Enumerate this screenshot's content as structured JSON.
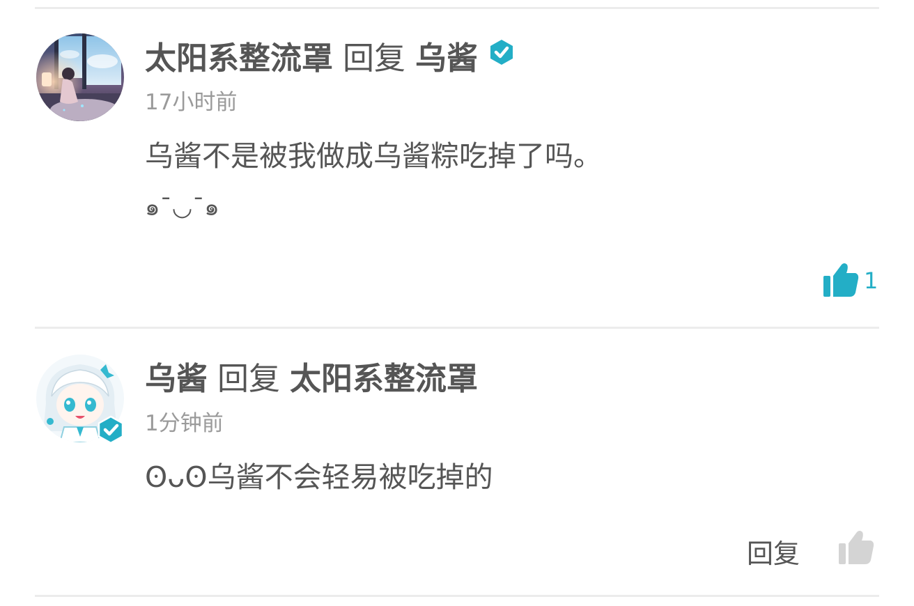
{
  "comments": [
    {
      "author": "太阳系整流罩",
      "reply_word": "回复",
      "target": "乌酱",
      "target_verified": true,
      "time": "17小时前",
      "text": "乌酱不是被我做成乌酱粽吃掉了吗。",
      "emoticon": "๑¯◡¯๑",
      "likes": "1",
      "like_active": true
    },
    {
      "author": "乌酱",
      "author_verified": true,
      "reply_word": "回复",
      "target": "太阳系整流罩",
      "time": "1分钟前",
      "text": "ʘᴗʘ乌酱不会轻易被吃掉的",
      "reply_action": "回复",
      "like_active": false
    }
  ],
  "colors": {
    "accent": "#23aec6",
    "text": "#555555",
    "muted": "#9a9a9a",
    "divider": "#ececec",
    "inactive_icon": "#d4d4d4"
  },
  "icons": {
    "verified": "verified-check-badge-icon",
    "like": "thumbs-up-icon"
  }
}
